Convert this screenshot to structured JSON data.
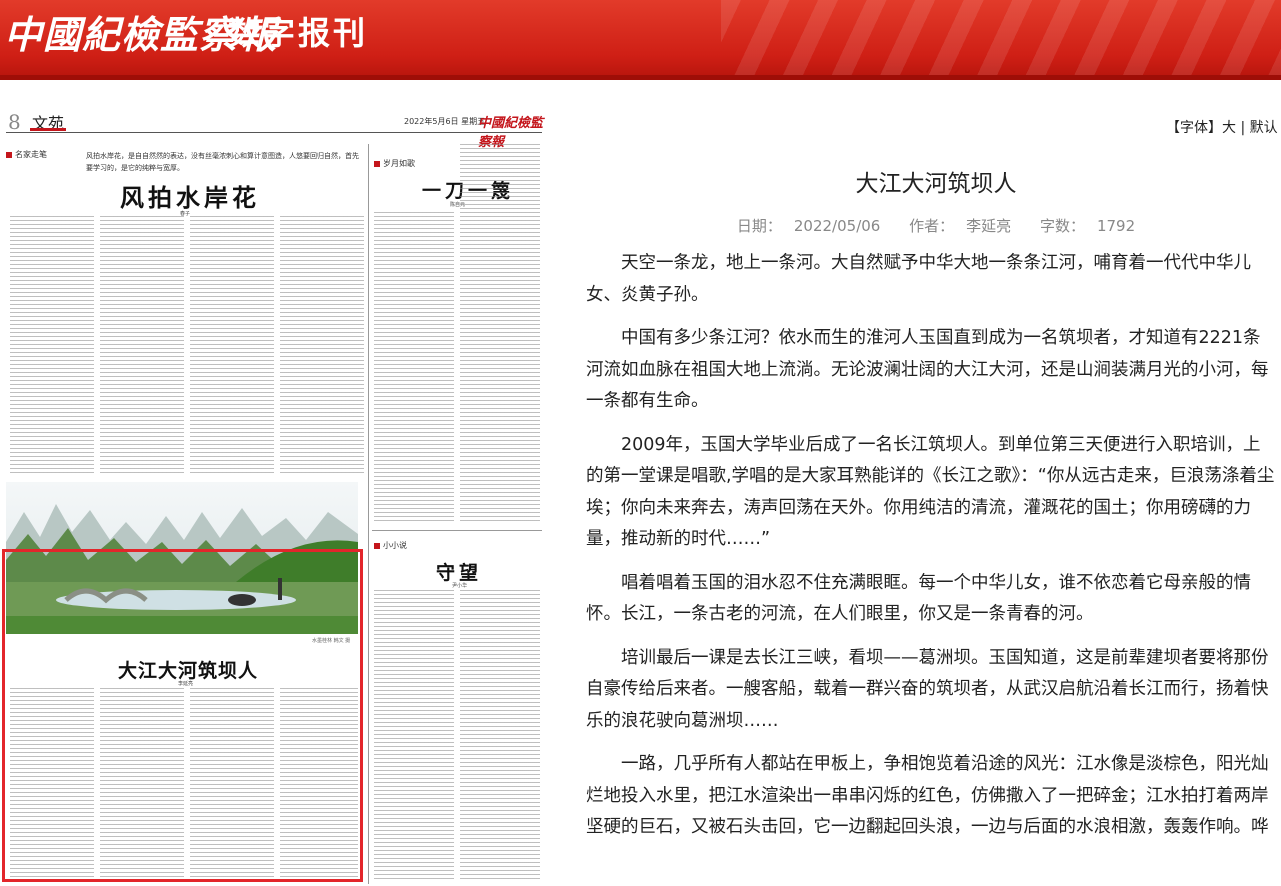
{
  "header": {
    "brand": "中國紀檢監察報",
    "section": "数字报刊"
  },
  "page": {
    "number": "8",
    "section": "文苑",
    "date": "2022年5月6日  星期五",
    "logo": "中國紀檢監察報",
    "columns": {
      "mingjia": "名家走笔",
      "suiyue": "岁月如歌",
      "xiaoxiaoshuo": "小小说"
    },
    "lead": "风拍水岸花，是自自然然的表达，没有丝毫浓刺心和算计意图造，人悠要回归自然，首先要学习的，是它的纯粹与宽厚。",
    "articles": {
      "fengpai": {
        "title": "风拍水岸花",
        "author": "春子"
      },
      "yidao": {
        "title": "一刀一篾",
        "author": "陈自元"
      },
      "shouwang": {
        "title": "守望",
        "author": "尹小华"
      },
      "dajiang": {
        "title": "大江大河筑坝人",
        "author": "李延亮"
      }
    },
    "photo_caption": "水墨桂林  韩文 摄"
  },
  "font_control": {
    "prefix": "【字体】",
    "large": "大",
    "sep": " | ",
    "default": "默认"
  },
  "article": {
    "title": "大江大河筑坝人",
    "date_label": "日期：",
    "date": "2022/05/06",
    "author_label": "作者：",
    "author": "李延亮",
    "words_label": "字数：",
    "words": "1792",
    "paragraphs": [
      "天空一条龙，地上一条河。大自然赋予中华大地一条条江河，哺育着一代代中华儿女、炎黄子孙。",
      "中国有多少条江河？依水而生的淮河人玉国直到成为一名筑坝者，才知道有2221条河流如血脉在祖国大地上流淌。无论波澜壮阔的大江大河，还是山涧装满月光的小河，每一条都有生命。",
      "2009年，玉国大学毕业后成了一名长江筑坝人。到单位第三天便进行入职培训，上的第一堂课是唱歌,学唱的是大家耳熟能详的《长江之歌》：“你从远古走来，巨浪荡涤着尘埃；你向未来奔去，涛声回荡在天外。你用纯洁的清流，灌溉花的国土；你用磅礴的力量，推动新的时代……”",
      "唱着唱着玉国的泪水忍不住充满眼眶。每一个中华儿女，谁不依恋着它母亲般的情怀。长江，一条古老的河流，在人们眼里，你又是一条青春的河。",
      "培训最后一课是去长江三峡，看坝——葛洲坝。玉国知道，这是前辈建坝者要将那份自豪传给后来者。一艘客船，载着一群兴奋的筑坝者，从武汉启航沿着长江而行，扬着快乐的浪花驶向葛洲坝……",
      "一路，几乎所有人都站在甲板上，争相饱览着沿途的风光：江水像是淡棕色，阳光灿烂地投入水里，把江水渲染出一串串闪烁的红色，仿佛撒入了一把碎金；江水拍打着两岸坚硬的巨石，又被石头击回，它一边翻起回头浪，一边与后面的水浪相激，轰轰作响。哗"
    ]
  }
}
